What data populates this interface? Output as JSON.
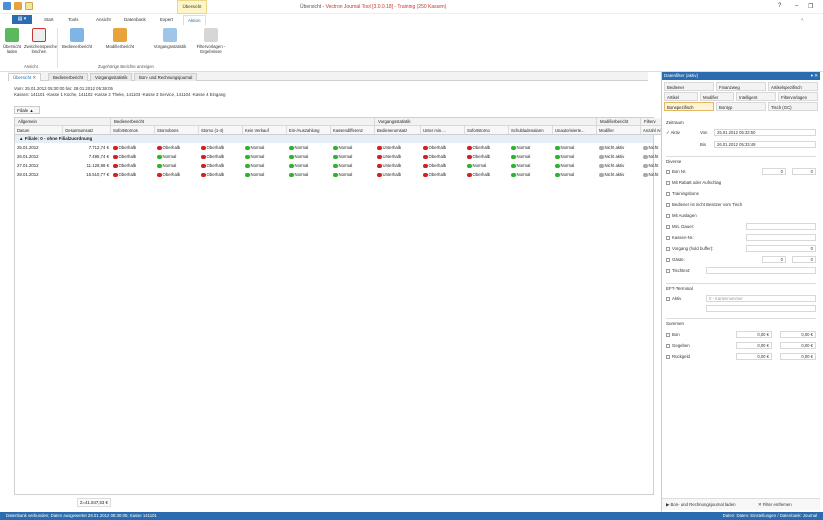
{
  "window": {
    "title_prefix": "Übersicht - ",
    "title_app": "Vectron Journal Tool [3.0.0.18] - Training (250 Kassen)",
    "context_tab": "Übersicht",
    "controls": {
      "help": "?",
      "minimize": "–",
      "restore": "❐"
    }
  },
  "ribbon": {
    "file_label": "▤ ▾",
    "tabs": [
      "Start",
      "Tools",
      "Ansicht",
      "Datenbank",
      "Expert",
      "Aktion"
    ],
    "active_tab": "Aktion",
    "buttons": [
      {
        "label": "Übersicht laden",
        "icon": "refresh-green-icon"
      },
      {
        "label": "Zwischenspeicher löschen",
        "icon": "delete-cache-icon"
      },
      {
        "label": "Bedienerbericht",
        "icon": "user-report-icon"
      },
      {
        "label": "Modifierbericht",
        "icon": "modifier-report-icon"
      },
      {
        "label": "Vorgangsstatistik",
        "icon": "statistics-icon"
      },
      {
        "label": "Filtervorlagen - Ergebnisse",
        "icon": "filter-icon"
      }
    ],
    "groups": [
      "Ansicht",
      "Zugehörige Berichte anzeigen"
    ]
  },
  "doc_tabs": [
    "Übersicht",
    "Bedienerbericht",
    "Vorgangsstatistik",
    "Bon- und Rechnungsjournal"
  ],
  "info": {
    "line1": "Vom: 25.01.2012 05:30:00 bis: 28.01.2012 05:38:05",
    "line2": "Kassen: 141101 -Kasse 1 Küche, 141102 -Kasse 2 Theke, 141103 -Kasse 3 Service, 141104 -Kasse 4 Eingang"
  },
  "filiale_button": "Filiale ▲",
  "grid": {
    "group_headers": [
      "Allgemein",
      "Bedienerbericht",
      "Vorgangsstatistik",
      "Modifierbericht",
      "Filterv"
    ],
    "columns": [
      "Datum",
      "Gesamtumsatz",
      "Sofortstornos",
      "Stornobons",
      "Storno (1-4)",
      "Kein Verkauf",
      "Ein-/Auszahlung",
      "Kassendifferenz",
      "Bedienerumsatz",
      "Unter min....",
      "Sofortstorno",
      "Schubladenalarm",
      "Unautorisierte...",
      "Modifier",
      "Anzahl An"
    ],
    "group_row": "▲ Filiale: 0 - ohne Filialzuordnung",
    "rows": [
      {
        "date": "25.01.2012",
        "total": "7.712,74 €",
        "s": [
          [
            "red",
            "Oberhalb"
          ],
          [
            "red",
            "Oberhalb"
          ],
          [
            "red",
            "Oberhalb"
          ],
          [
            "green",
            "Normal"
          ],
          [
            "green",
            "Normal"
          ],
          [
            "green",
            "Normal"
          ],
          [
            "red",
            "Unterhalb"
          ],
          [
            "red",
            "Oberhalb"
          ],
          [
            "red",
            "Oberhalb"
          ],
          [
            "green",
            "Normal"
          ],
          [
            "green",
            "Normal"
          ],
          [
            "gray",
            "Nicht aktiv"
          ],
          [
            "gray",
            "Nicht"
          ]
        ]
      },
      {
        "date": "26.01.2012",
        "total": "7.495,74 €",
        "s": [
          [
            "red",
            "Oberhalb"
          ],
          [
            "green",
            "Normal"
          ],
          [
            "red",
            "Oberhalb"
          ],
          [
            "green",
            "Normal"
          ],
          [
            "green",
            "Normal"
          ],
          [
            "green",
            "Normal"
          ],
          [
            "red",
            "Unterhalb"
          ],
          [
            "red",
            "Oberhalb"
          ],
          [
            "red",
            "Oberhalb"
          ],
          [
            "green",
            "Normal"
          ],
          [
            "green",
            "Normal"
          ],
          [
            "gray",
            "Nicht aktiv"
          ],
          [
            "gray",
            "Nicht"
          ]
        ]
      },
      {
        "date": "27.01.2012",
        "total": "11.128,88 €",
        "s": [
          [
            "red",
            "Oberhalb"
          ],
          [
            "green",
            "Normal"
          ],
          [
            "red",
            "Oberhalb"
          ],
          [
            "green",
            "Normal"
          ],
          [
            "green",
            "Normal"
          ],
          [
            "green",
            "Normal"
          ],
          [
            "red",
            "Unterhalb"
          ],
          [
            "red",
            "Oberhalb"
          ],
          [
            "green",
            "Normal"
          ],
          [
            "green",
            "Normal"
          ],
          [
            "green",
            "Normal"
          ],
          [
            "gray",
            "Nicht aktiv"
          ],
          [
            "gray",
            "Nicht"
          ]
        ]
      },
      {
        "date": "28.01.2012",
        "total": "15.510,77 €",
        "s": [
          [
            "red",
            "Oberhalb"
          ],
          [
            "red",
            "Oberhalb"
          ],
          [
            "red",
            "Oberhalb"
          ],
          [
            "green",
            "Normal"
          ],
          [
            "green",
            "Normal"
          ],
          [
            "green",
            "Normal"
          ],
          [
            "red",
            "Unterhalb"
          ],
          [
            "red",
            "Oberhalb"
          ],
          [
            "red",
            "Oberhalb"
          ],
          [
            "green",
            "Normal"
          ],
          [
            "green",
            "Normal"
          ],
          [
            "gray",
            "Nicht aktiv"
          ],
          [
            "gray",
            "Nicht"
          ]
        ]
      }
    ],
    "summary": "Σ=41.847,53 €"
  },
  "panel": {
    "title": "Datenfilter (aktiv)",
    "close": "▾ ✕",
    "tabs": [
      "Bediener",
      "Finanzweg",
      "Artikelspezifisch",
      "Artikel",
      "Modifier",
      "Intelligent",
      "Filtervorlagen",
      "Bonspezifisch",
      "Bontyp",
      "Tisch (GC)"
    ],
    "zeitraum": {
      "label": "Zeitraum",
      "aktiv": "Aktiv",
      "von_label": "Von",
      "von": "25.01.2012 05:33:50",
      "bis_label": "Bis",
      "bis": "26.01.2012 05:33:49"
    },
    "diverse": {
      "label": "Diverse",
      "bon_nr": "Bon Nr.",
      "bon_from": "0",
      "bon_to": "0",
      "rabatt": "Mit Rabatt oder Aufschlag",
      "training": "Trainingsbons",
      "besitzer": "Bediener ist nicht Besitzer vom Tisch",
      "auslagen": "Mit Auslagen",
      "dauer": "Min. Dauer:",
      "kassennr": "Kassen-Nr.:",
      "vorgang": "Vorgang (hold buffer):",
      "vorgang_val": "0",
      "gaeste": "Gäste:",
      "gaeste_from": "0",
      "gaeste_to": "0",
      "tischtext": "Tischtext:"
    },
    "ept": {
      "label": "EFT-Terminal",
      "aktiv": "Aktiv",
      "placeholder": "0 - Kartennummer"
    },
    "summen": {
      "label": "Summen",
      "bon": "Bon",
      "gegeben": "Gegeben",
      "rueckgeld": "Rückgeld",
      "zero": "0,00 €"
    },
    "footer_journal": "Bon- und Rechnungsjournal laden",
    "footer_remove": "Filter entfernen"
  },
  "status": {
    "left": "Datenbank verbunden; Daten ausgewertet 28.01.2012 08:30:05; Kasse 141101",
    "right": "Daten: Daten: Einstellungen / Datenbank: Journal"
  }
}
